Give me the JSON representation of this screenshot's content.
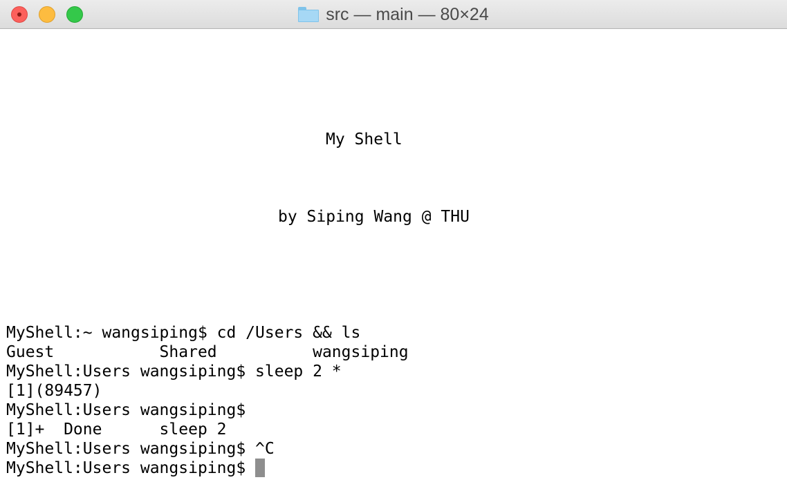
{
  "window": {
    "title": "src — main — 80×24"
  },
  "terminal": {
    "banner_title": "My Shell",
    "banner_author": "by Siping Wang @ THU",
    "lines": [
      "MyShell:~ wangsiping$ cd /Users && ls",
      "Guest           Shared          wangsiping",
      "MyShell:Users wangsiping$ sleep 2 *",
      "[1](89457)",
      "MyShell:Users wangsiping$",
      "[1]+  Done      sleep 2",
      "MyShell:Users wangsiping$ ^C",
      "MyShell:Users wangsiping$"
    ]
  },
  "colors": {
    "close": "#fc605c",
    "minimize": "#fdbc40",
    "zoom": "#34c84a",
    "cursor": "#8e8e8e",
    "text": "#000000"
  },
  "icons": [
    "close-icon",
    "minimize-icon",
    "zoom-icon",
    "folder-icon",
    "cursor-block"
  ]
}
